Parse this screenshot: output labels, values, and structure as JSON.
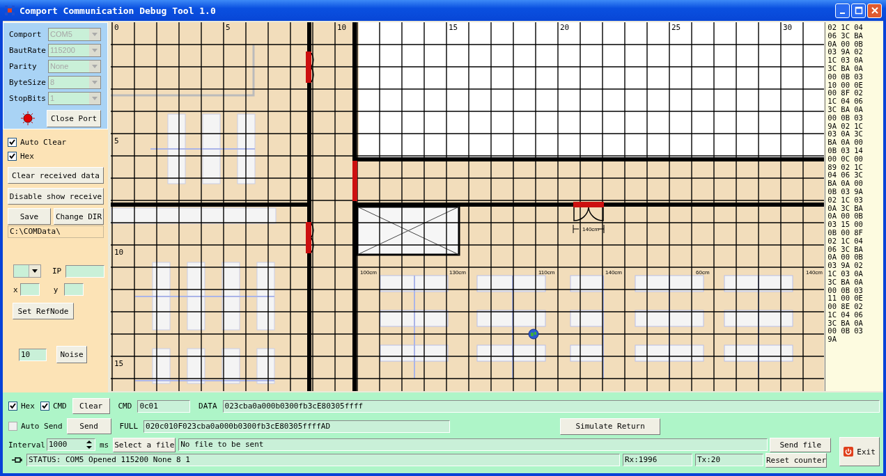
{
  "window": {
    "title": "Comport Communication Debug Tool 1.0"
  },
  "port_settings": {
    "fields": [
      {
        "label": "Comport",
        "value": "COM5",
        "disabled": true
      },
      {
        "label": "BautRate",
        "value": "115200",
        "disabled": true
      },
      {
        "label": "Parity",
        "value": "None",
        "disabled": true
      },
      {
        "label": "ByteSize",
        "value": "8",
        "disabled": true
      },
      {
        "label": "StopBits",
        "value": "1",
        "disabled": true
      }
    ],
    "led_on": true,
    "close_port_button": "Close Port"
  },
  "receive_options": {
    "checkboxes": [
      {
        "label": "Auto Clear",
        "checked": true
      },
      {
        "label": "Hex",
        "checked": true
      }
    ],
    "buttons": [
      "Clear received data",
      "Disable show receive"
    ],
    "save_button": "Save",
    "change_dir_button": "Change DIR",
    "path": "C:\\COMData\\"
  },
  "ref_node": {
    "ip_label": "IP",
    "x_label": "x",
    "y_label": "y",
    "button": "Set RefNode"
  },
  "noise": {
    "value": "10",
    "button": "Noise"
  },
  "map": {
    "x_labels": [
      "0",
      "5",
      "10",
      "15",
      "20",
      "25",
      "30"
    ],
    "y_labels": [
      "5",
      "10",
      "15"
    ],
    "dimension_labels": [
      "100cm",
      "130cm",
      "110cm",
      "140cm",
      "60cm",
      "140cm"
    ],
    "door_label": "140cm"
  },
  "received_hex": [
    "02 1C 04",
    "06 3C BA",
    "0A 00 0B",
    "03 9A 02",
    "1C 03 0A",
    "3C BA 0A",
    "00 0B 03",
    "10 00 0E",
    "00 8F 02",
    "1C 04 06",
    "3C BA 0A",
    "00 0B 03",
    "9A 02 1C",
    "03 0A 3C",
    "BA 0A 00",
    "0B 03 14",
    "00 0C 00",
    "89 02 1C",
    "04 06 3C",
    "BA 0A 00",
    "0B 03 9A",
    "02 1C 03",
    "0A 3C BA",
    "0A 00 0B",
    "03 15 00",
    "0B 00 8F",
    "02 1C 04",
    "06 3C BA",
    "0A 00 0B",
    "03 9A 02",
    "1C 03 0A",
    "3C BA 0A",
    "00 0B 03",
    "11 00 0E",
    "00 8E 02",
    "1C 04 06",
    "3C BA 0A",
    "00 0B 03",
    "9A"
  ],
  "send": {
    "checkboxes": [
      {
        "label": "Hex",
        "checked": true
      },
      {
        "label": "CMD",
        "checked": true
      }
    ],
    "clear_button": "Clear",
    "cmd_label": "CMD",
    "cmd_value": "0c01",
    "data_label": "DATA",
    "data_value": "023cba0a000b0300fb3cE80305ffff",
    "auto_send": {
      "label": "Auto Send",
      "checked": false
    },
    "send_button": "Send",
    "full_label": "FULL",
    "full_value": "020c010F023cba0a000b0300fb3cE80305ffffAD",
    "simulate_button": "Simulate Return",
    "interval_label": "Interval",
    "interval_value": "1000",
    "interval_unit": "ms",
    "select_file_button": "Select a file",
    "file_value": "No file to be sent",
    "send_file_button": "Send file",
    "reset_counter_button": "Reset counter"
  },
  "status_bar": {
    "status": "STATUS: COM5 Opened 115200 None 8 1",
    "rx": "Rx:1996",
    "tx": "Tx:20"
  },
  "exit_button": "Exit"
}
